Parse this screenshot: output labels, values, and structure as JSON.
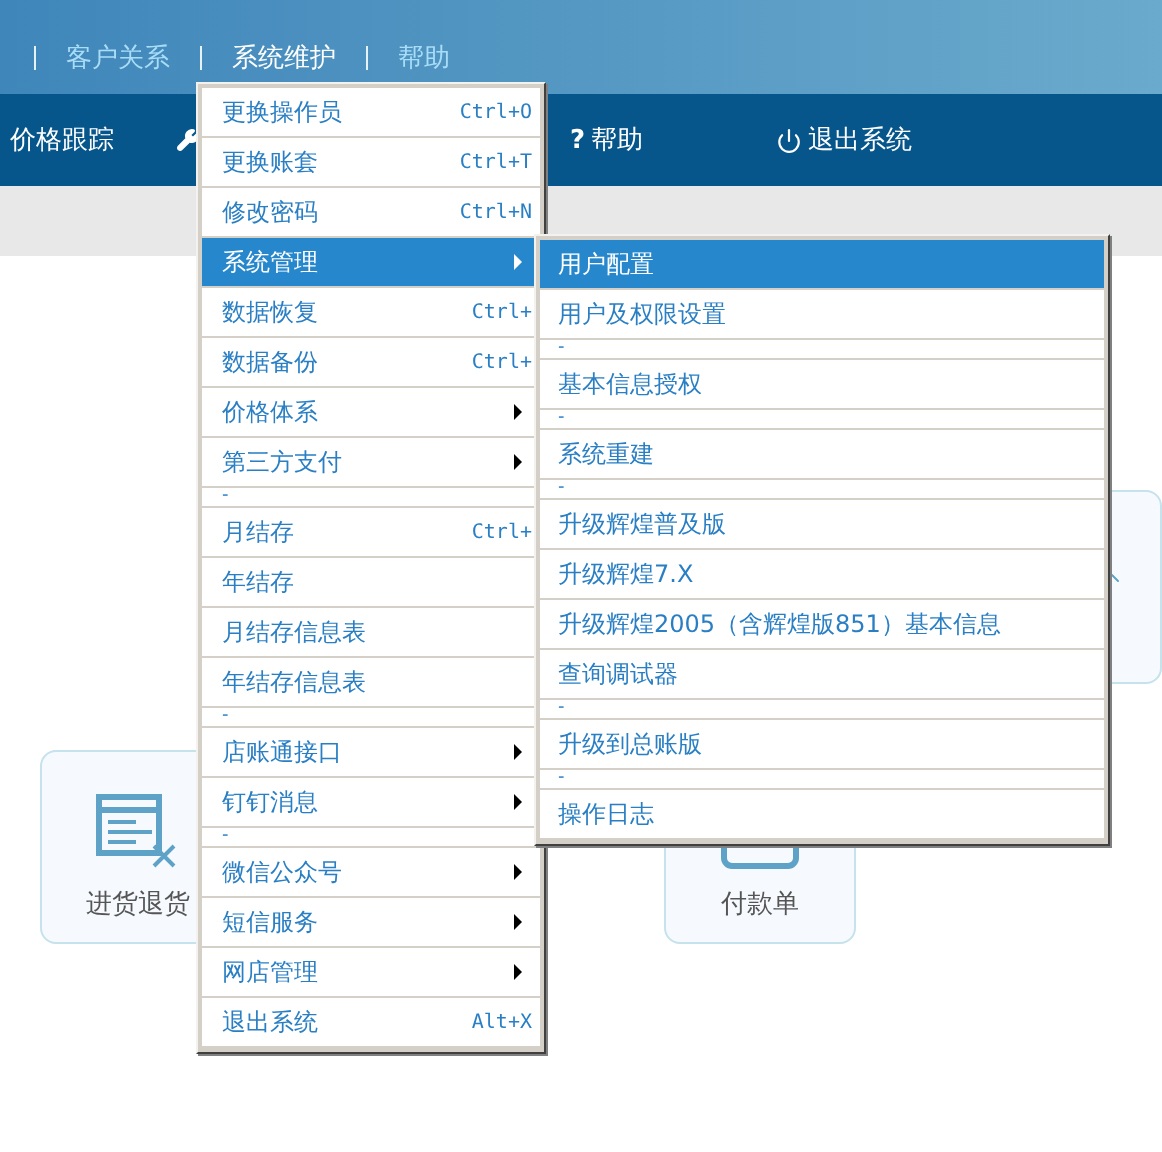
{
  "menu_bar": [
    {
      "label": "客户关系",
      "selected": false
    },
    {
      "label": "系统维护",
      "selected": true
    },
    {
      "label": "帮助",
      "selected": false
    }
  ],
  "toolbar": [
    {
      "kind": "text",
      "label": "价格跟踪"
    },
    {
      "kind": "wrench"
    },
    {
      "kind": "glyph",
      "glyph": "?",
      "label": "帮助"
    },
    {
      "kind": "power",
      "label": "退出系统"
    }
  ],
  "menu": [
    {
      "kind": "item",
      "label": "更换操作员",
      "shortcut": "Ctrl+O",
      "submenu": false,
      "selected": false
    },
    {
      "kind": "item",
      "label": "更换账套",
      "shortcut": "Ctrl+T",
      "submenu": false,
      "selected": false
    },
    {
      "kind": "item",
      "label": "修改密码",
      "shortcut": "Ctrl+N",
      "submenu": false,
      "selected": false
    },
    {
      "kind": "item",
      "label": "系统管理",
      "submenu": true,
      "selected": true
    },
    {
      "kind": "item",
      "label": "数据恢复",
      "shortcut": "Ctrl+",
      "submenu": false,
      "selected": false
    },
    {
      "kind": "item",
      "label": "数据备份",
      "shortcut": "Ctrl+",
      "submenu": false,
      "selected": false
    },
    {
      "kind": "item",
      "label": "价格体系",
      "submenu": true,
      "selected": false
    },
    {
      "kind": "item",
      "label": "第三方支付",
      "submenu": true,
      "selected": false
    },
    {
      "kind": "separator",
      "label": "-"
    },
    {
      "kind": "item",
      "label": "月结存",
      "shortcut": "Ctrl+",
      "submenu": false,
      "selected": false
    },
    {
      "kind": "item",
      "label": "年结存",
      "submenu": false,
      "selected": false
    },
    {
      "kind": "item",
      "label": "月结存信息表",
      "submenu": false,
      "selected": false
    },
    {
      "kind": "item",
      "label": "年结存信息表",
      "submenu": false,
      "selected": false
    },
    {
      "kind": "separator",
      "label": "-"
    },
    {
      "kind": "item",
      "label": "店账通接口",
      "submenu": true,
      "selected": false
    },
    {
      "kind": "item",
      "label": "钉钉消息",
      "submenu": true,
      "selected": false
    },
    {
      "kind": "separator",
      "label": "-"
    },
    {
      "kind": "item",
      "label": "微信公众号",
      "submenu": true,
      "selected": false
    },
    {
      "kind": "item",
      "label": "短信服务",
      "submenu": true,
      "selected": false
    },
    {
      "kind": "item",
      "label": "网店管理",
      "submenu": true,
      "selected": false
    },
    {
      "kind": "item",
      "label": "退出系统",
      "shortcut": "Alt+X",
      "submenu": false,
      "selected": false
    }
  ],
  "submenu": [
    {
      "kind": "item",
      "label": "用户配置",
      "selected": true
    },
    {
      "kind": "item",
      "label": "用户及权限设置",
      "selected": false
    },
    {
      "kind": "separator",
      "label": "-"
    },
    {
      "kind": "item",
      "label": "基本信息授权",
      "selected": false
    },
    {
      "kind": "separator",
      "label": "-"
    },
    {
      "kind": "item",
      "label": "系统重建",
      "selected": false
    },
    {
      "kind": "separator",
      "label": "-"
    },
    {
      "kind": "item",
      "label": "升级辉煌普及版",
      "selected": false
    },
    {
      "kind": "item",
      "label": "升级辉煌7.X",
      "selected": false
    },
    {
      "kind": "item",
      "label": "升级辉煌2005（含辉煌版851）基本信息",
      "selected": false
    },
    {
      "kind": "item",
      "label": "查询调试器",
      "selected": false
    },
    {
      "kind": "separator",
      "label": "-"
    },
    {
      "kind": "item",
      "label": "升级到总账版",
      "selected": false
    },
    {
      "kind": "separator",
      "label": "-"
    },
    {
      "kind": "item",
      "label": "操作日志",
      "selected": false
    }
  ],
  "cards": [
    {
      "kind": "return",
      "label": "进货退货"
    },
    {
      "kind": "payment",
      "label": "付款单"
    }
  ]
}
